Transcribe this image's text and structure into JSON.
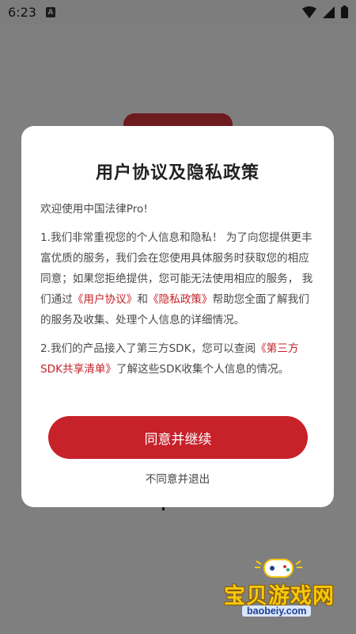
{
  "status_bar": {
    "time": "6:23",
    "notification_icon_letter": "A"
  },
  "dialog": {
    "title": "用户协议及隐私政策",
    "welcome": "欢迎使用中国法律Pro!",
    "para1": {
      "text1": "1.我们非常重视您的个人信息和隐私！ 为了向您提供更丰富优质的服务，我们会在您使用具体服务时获取您的相应同意；如果您拒绝提供，您可能无法使用相应的服务， 我们通过",
      "link_user_agreement": "《用户协议》",
      "text2": "和",
      "link_privacy_policy": "《隐私政策》",
      "text3": "帮助您全面了解我们的服务及收集、处理个人信息的详细情况。"
    },
    "para2": {
      "text1": "2.我们的产品接入了第三方SDK，您可以查阅",
      "link_sdk_list": "《第三方SDK共享清单》",
      "text2": "了解这些SDK收集个人信息的情况。"
    },
    "agree_button": "同意并继续",
    "disagree_button": "不同意并退出"
  },
  "watermark": {
    "title": "宝贝游戏网",
    "url": "baobeiy.com"
  },
  "colors": {
    "accent_red": "#c7212a",
    "link_red": "#c62027",
    "overlay_gray": "#7f7f7f"
  }
}
